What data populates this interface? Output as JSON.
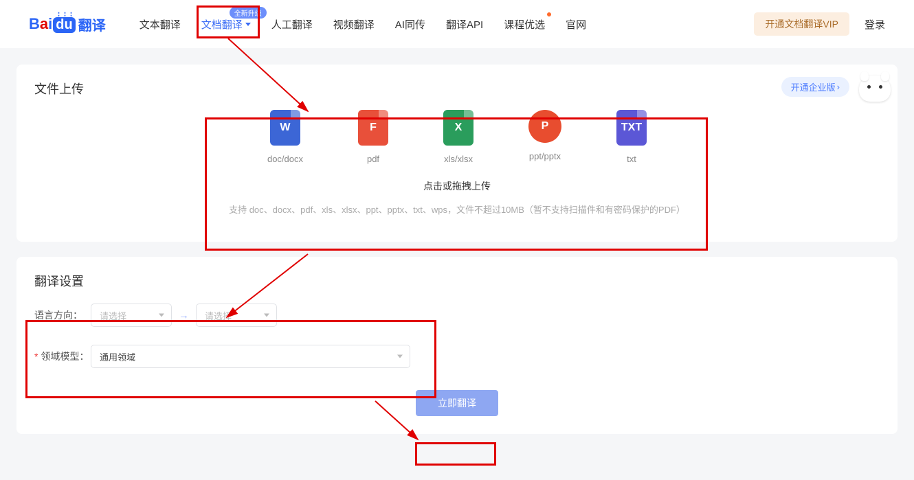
{
  "logo": {
    "cn": "翻译"
  },
  "nav": {
    "items": [
      {
        "label": "文本翻译"
      },
      {
        "label": "文档翻译",
        "active": true,
        "badge": "全新升级"
      },
      {
        "label": "人工翻译"
      },
      {
        "label": "视频翻译"
      },
      {
        "label": "AI同传"
      },
      {
        "label": "翻译API"
      },
      {
        "label": "课程优选",
        "dot": true
      },
      {
        "label": "官网"
      }
    ]
  },
  "header_right": {
    "vip": "开通文档翻译VIP",
    "login": "登录"
  },
  "upload": {
    "title": "文件上传",
    "enterprise": "开通企业版",
    "types": {
      "word": {
        "glyph": "W",
        "label": "doc/docx"
      },
      "pdf": {
        "glyph": "F",
        "label": "pdf"
      },
      "xls": {
        "glyph": "X",
        "label": "xls/xlsx"
      },
      "ppt": {
        "glyph": "P",
        "label": "ppt/pptx"
      },
      "txt": {
        "glyph": "TXT",
        "label": "txt"
      }
    },
    "tip": "点击或拖拽上传",
    "note": "支持 doc、docx、pdf、xls、xlsx、ppt、pptx、txt、wps，文件不超过10MB（暂不支持扫描件和有密码保护的PDF）"
  },
  "settings": {
    "title": "翻译设置",
    "lang_label": "语言方向：",
    "lang_placeholder": "请选择",
    "domain_label": "领域模型：",
    "domain_value": "通用领域"
  },
  "action": {
    "translate": "立即翻译"
  }
}
